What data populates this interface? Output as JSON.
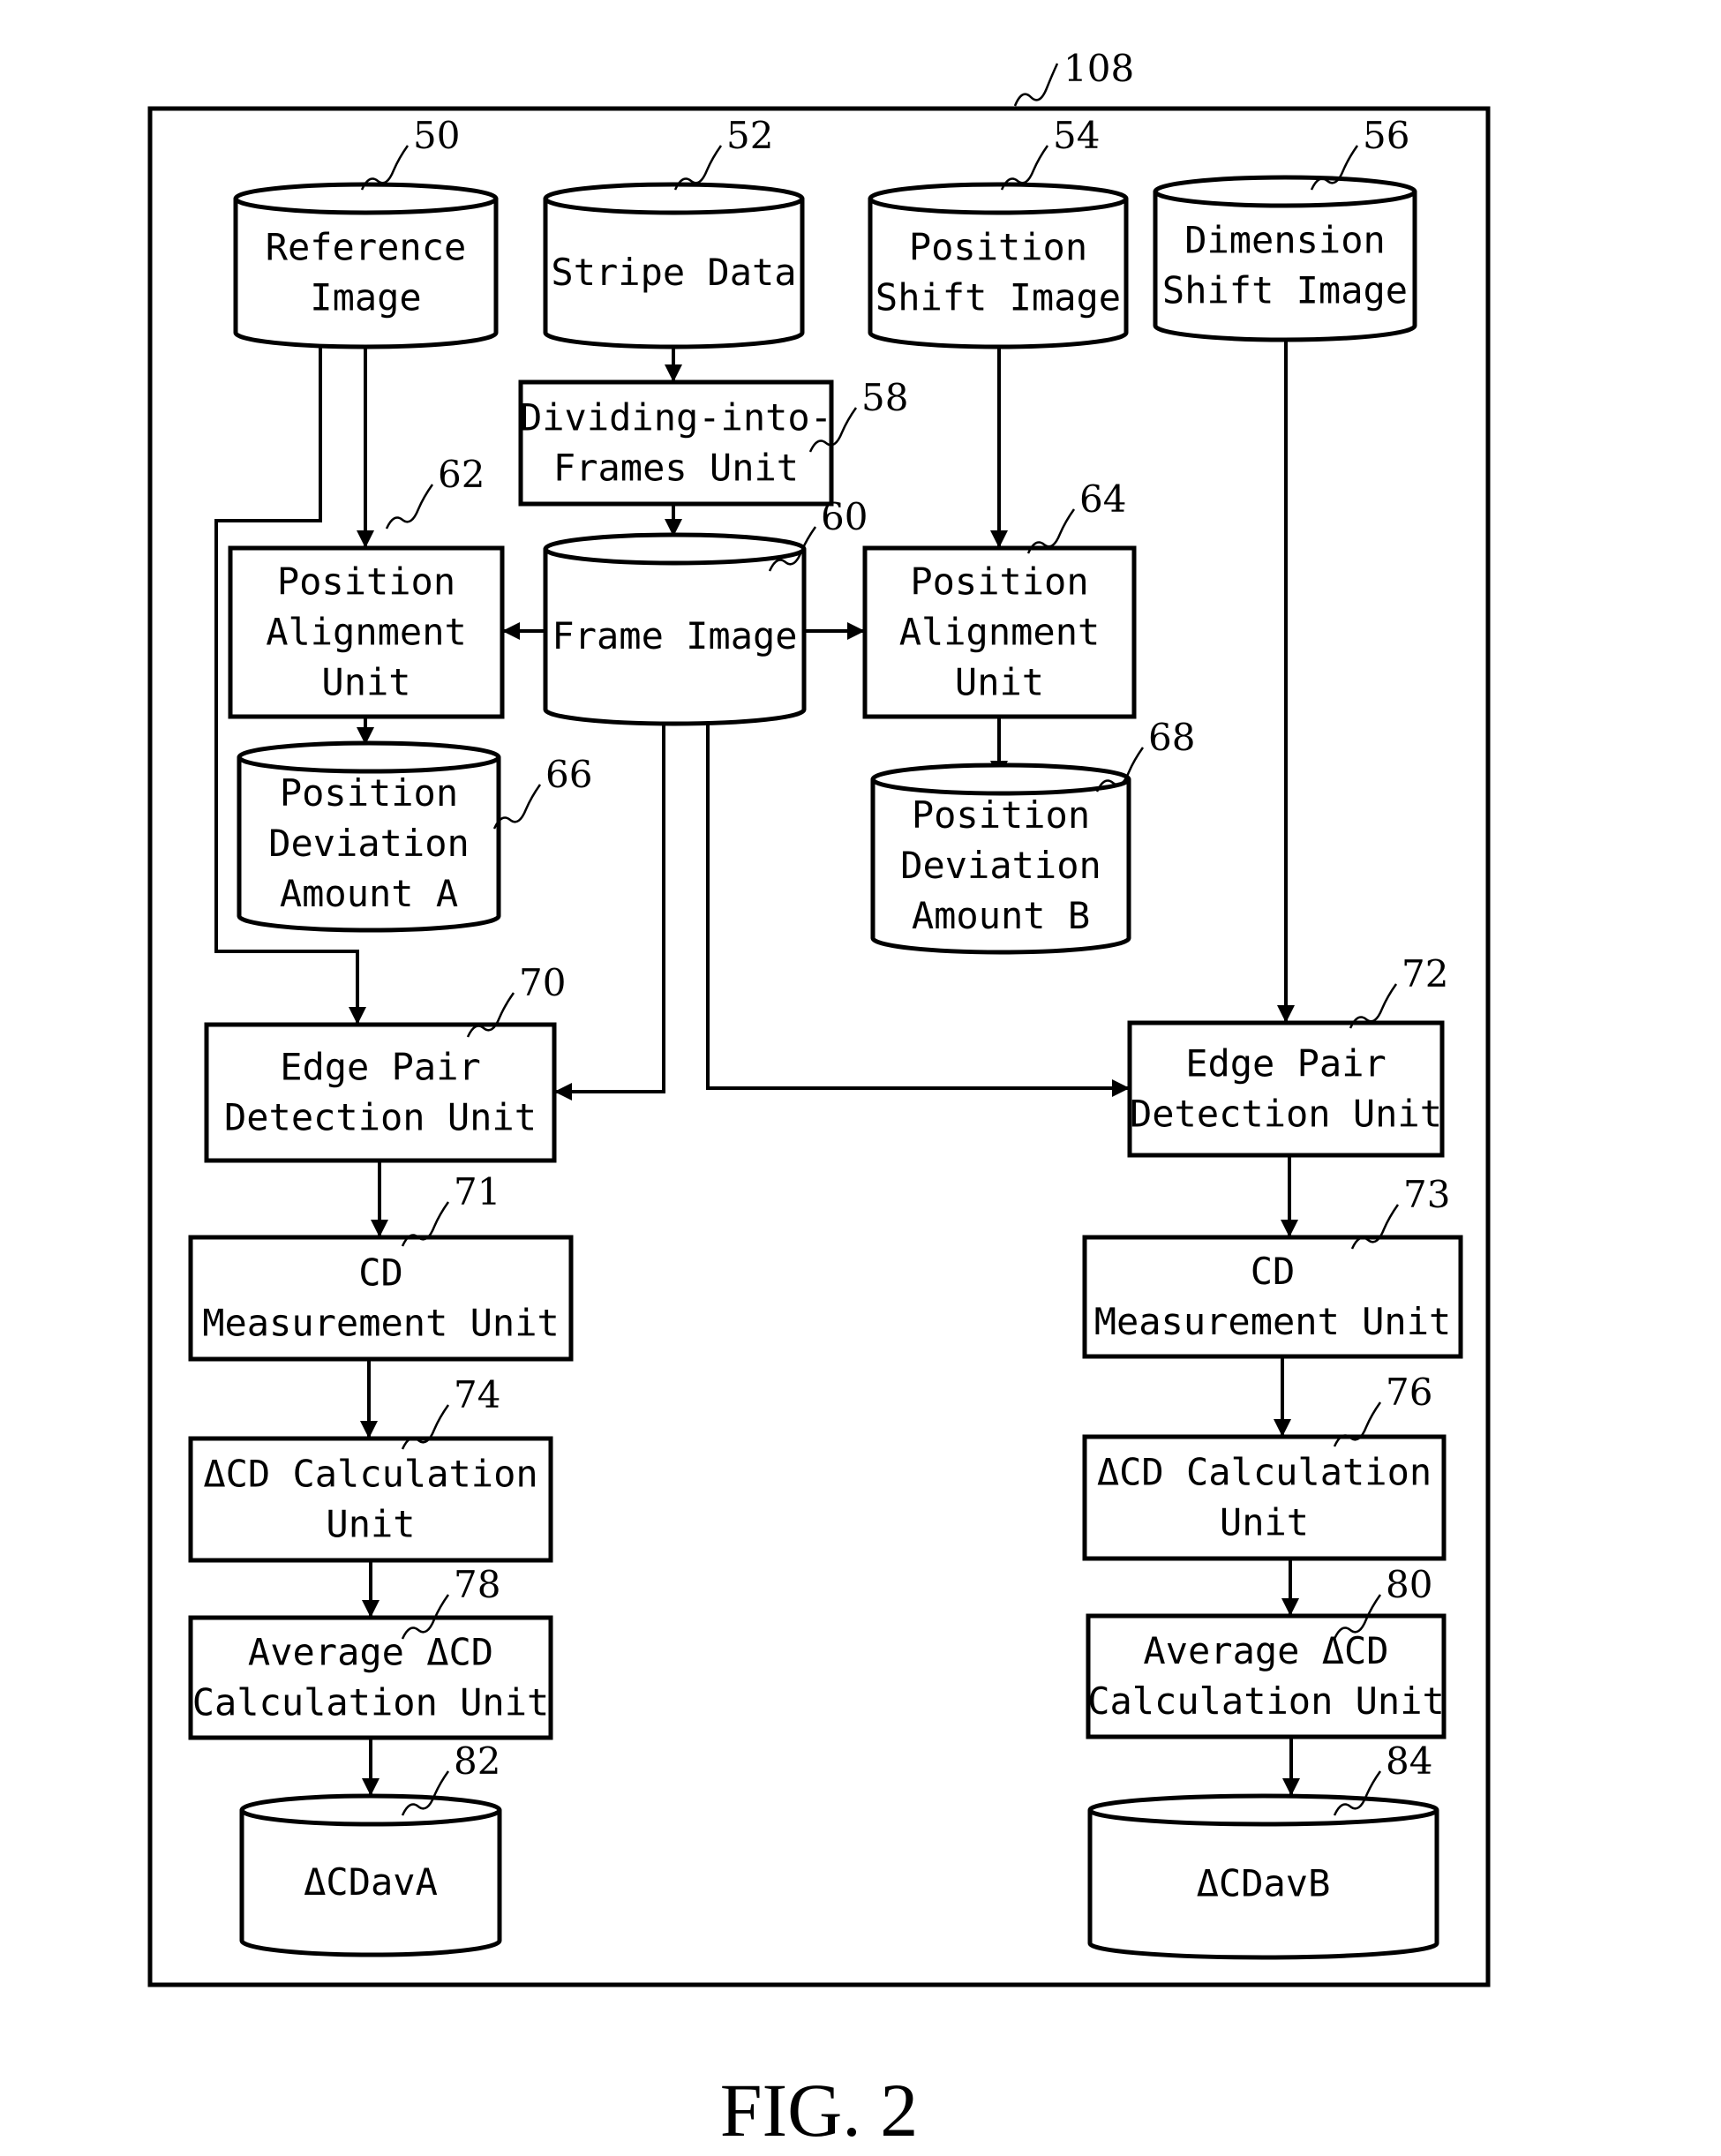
{
  "figure": {
    "caption": "FIG. 2",
    "container": {
      "ref": "108"
    }
  },
  "nodes": {
    "reference_image": {
      "ref": "50",
      "shape": "database",
      "lines": [
        "Reference",
        "Image"
      ]
    },
    "stripe_data": {
      "ref": "52",
      "shape": "database",
      "lines": [
        "Stripe Data"
      ]
    },
    "position_shift_image": {
      "ref": "54",
      "shape": "database",
      "lines": [
        "Position",
        "Shift Image"
      ]
    },
    "dimension_shift_image": {
      "ref": "56",
      "shape": "database",
      "lines": [
        "Dimension",
        "Shift Image"
      ]
    },
    "dividing_unit": {
      "ref": "58",
      "shape": "box",
      "lines": [
        "Dividing-into-",
        "Frames Unit"
      ]
    },
    "frame_image": {
      "ref": "60",
      "shape": "database",
      "lines": [
        "Frame Image"
      ]
    },
    "position_alignment_a": {
      "ref": "62",
      "shape": "box",
      "lines": [
        "Position",
        "Alignment",
        "Unit"
      ]
    },
    "position_alignment_b": {
      "ref": "64",
      "shape": "box",
      "lines": [
        "Position",
        "Alignment",
        "Unit"
      ]
    },
    "position_deviation_a": {
      "ref": "66",
      "shape": "database",
      "lines": [
        "Position",
        "Deviation",
        "Amount A"
      ]
    },
    "position_deviation_b": {
      "ref": "68",
      "shape": "database",
      "lines": [
        "Position",
        "Deviation",
        "Amount B"
      ]
    },
    "edge_pair_a": {
      "ref": "70",
      "shape": "box",
      "lines": [
        "Edge Pair",
        "Detection Unit"
      ]
    },
    "edge_pair_b": {
      "ref": "72",
      "shape": "box",
      "lines": [
        "Edge Pair",
        "Detection Unit"
      ]
    },
    "cd_measure_a": {
      "ref": "71",
      "shape": "box",
      "lines": [
        "CD",
        "Measurement Unit"
      ]
    },
    "cd_measure_b": {
      "ref": "73",
      "shape": "box",
      "lines": [
        "CD",
        "Measurement Unit"
      ]
    },
    "dcd_calc_a": {
      "ref": "74",
      "shape": "box",
      "lines": [
        "ΔCD Calculation",
        "Unit"
      ]
    },
    "dcd_calc_b": {
      "ref": "76",
      "shape": "box",
      "lines": [
        "ΔCD Calculation",
        "Unit"
      ]
    },
    "avg_dcd_a": {
      "ref": "78",
      "shape": "box",
      "lines": [
        "Average ΔCD",
        "Calculation Unit"
      ]
    },
    "avg_dcd_b": {
      "ref": "80",
      "shape": "box",
      "lines": [
        "Average ΔCD",
        "Calculation Unit"
      ]
    },
    "dcdav_a": {
      "ref": "82",
      "shape": "database",
      "lines": [
        "ΔCDavA"
      ]
    },
    "dcdav_b": {
      "ref": "84",
      "shape": "database",
      "lines": [
        "ΔCDavB"
      ]
    }
  },
  "edges": [
    {
      "from": "stripe_data",
      "to": "dividing_unit"
    },
    {
      "from": "dividing_unit",
      "to": "frame_image"
    },
    {
      "from": "reference_image",
      "to": "position_alignment_a"
    },
    {
      "from": "reference_image",
      "to": "edge_pair_a"
    },
    {
      "from": "position_shift_image",
      "to": "position_alignment_b"
    },
    {
      "from": "dimension_shift_image",
      "to": "edge_pair_b"
    },
    {
      "from": "frame_image",
      "to": "position_alignment_a"
    },
    {
      "from": "frame_image",
      "to": "position_alignment_b"
    },
    {
      "from": "frame_image",
      "to": "edge_pair_a"
    },
    {
      "from": "frame_image",
      "to": "edge_pair_b"
    },
    {
      "from": "position_alignment_a",
      "to": "position_deviation_a"
    },
    {
      "from": "position_alignment_b",
      "to": "position_deviation_b"
    },
    {
      "from": "edge_pair_a",
      "to": "cd_measure_a"
    },
    {
      "from": "edge_pair_b",
      "to": "cd_measure_b"
    },
    {
      "from": "cd_measure_a",
      "to": "dcd_calc_a"
    },
    {
      "from": "cd_measure_b",
      "to": "dcd_calc_b"
    },
    {
      "from": "dcd_calc_a",
      "to": "avg_dcd_a"
    },
    {
      "from": "dcd_calc_b",
      "to": "avg_dcd_b"
    },
    {
      "from": "avg_dcd_a",
      "to": "dcdav_a"
    },
    {
      "from": "avg_dcd_b",
      "to": "dcdav_b"
    }
  ]
}
